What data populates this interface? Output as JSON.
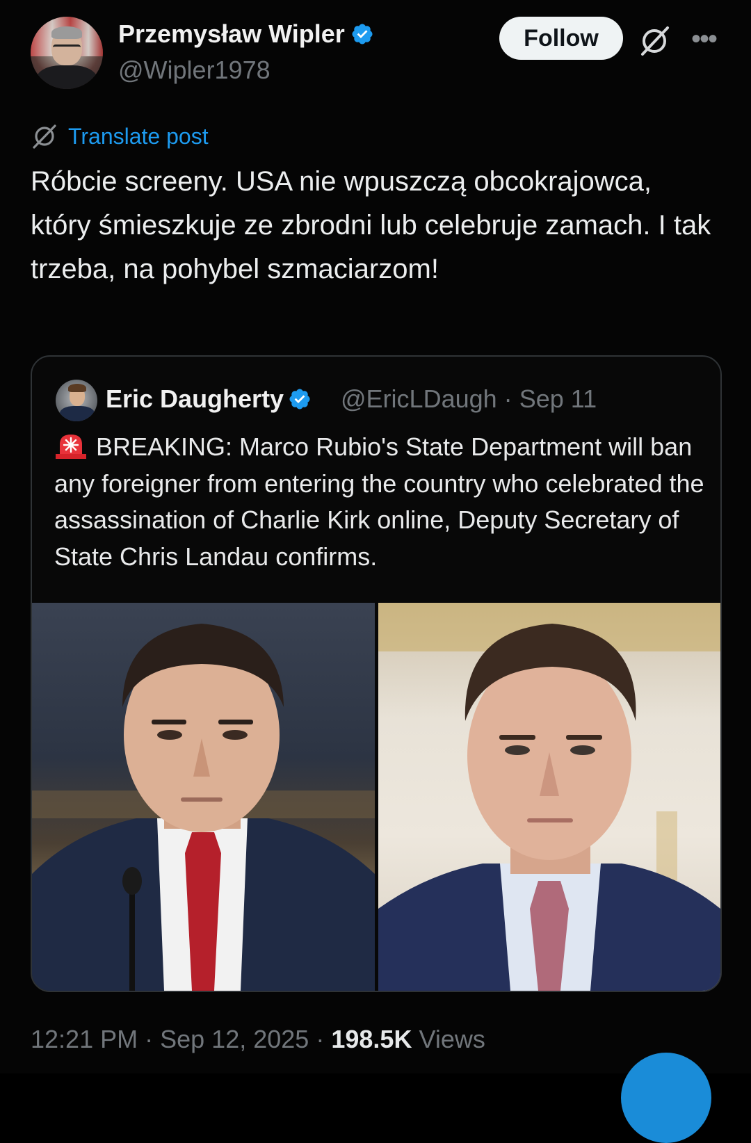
{
  "author": {
    "display_name": "Przemysław Wipler",
    "handle": "@Wipler1978",
    "verified": true
  },
  "header": {
    "follow_label": "Follow"
  },
  "translate_label": "Translate post",
  "post_text": "Róbcie screeny. USA nie wpuszczą obcokrajowca, który śmieszkuje ze zbrodni lub celebruje zamach. I tak trzeba, na pohybel szmaciarzom!",
  "quoted_post": {
    "display_name": "Eric Daugherty",
    "handle": "@EricLDaugh",
    "separator": "·",
    "date": "Sep 11",
    "text": "BREAKING: Marco Rubio's State Department will ban any foreigner from entering the country who celebrated the assassination of Charlie Kirk online, Deputy Secretary of State Chris Landau confirms.",
    "emoji_icon": "police-siren-icon"
  },
  "footer": {
    "time": "12:21 PM",
    "sep1": "·",
    "date": "Sep 12, 2025",
    "sep2": "·",
    "views_count": "198.5K",
    "views_label": "Views"
  },
  "colors": {
    "background": "#000000",
    "text": "#e7e9ea",
    "muted": "#71767b",
    "link": "#1d9bf0",
    "verified": "#1d9bf0",
    "follow_bg": "#eff3f4"
  }
}
